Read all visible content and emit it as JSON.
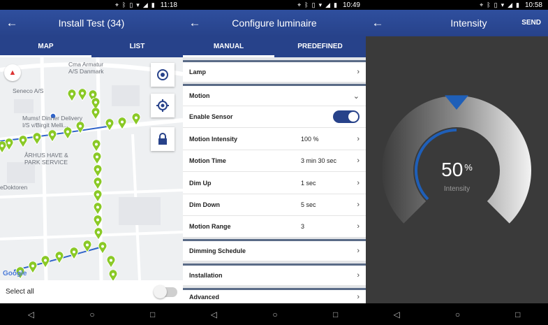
{
  "screen1": {
    "status_time": "11:18",
    "title": "Install Test (34)",
    "tabs": [
      "MAP",
      "LIST"
    ],
    "map_labels": {
      "label1": "Cma Armatur",
      "label2": "A/S Danmark",
      "label3": "Seneco A/S",
      "label4": "Mums! Dinner Delivery",
      "label5": "I/S v/Birgit Melli...",
      "label6": "ÅRHUS HAVE &",
      "label7": "PARK SERVICE",
      "label8": "eDoktoren"
    },
    "google": "Google",
    "select_all": "Select all"
  },
  "screen2": {
    "status_time": "10:49",
    "title": "Configure luminaire",
    "tabs": [
      "MANUAL",
      "PREDEFINED"
    ],
    "rows": {
      "lamp": "Lamp",
      "motion": "Motion",
      "enable_sensor": "Enable Sensor",
      "motion_intensity": {
        "label": "Motion Intensity",
        "value": "100 %"
      },
      "motion_time": {
        "label": "Motion Time",
        "value": "3 min 30 sec"
      },
      "dim_up": {
        "label": "Dim Up",
        "value": "1 sec"
      },
      "dim_down": {
        "label": "Dim Down",
        "value": "5 sec"
      },
      "motion_range": {
        "label": "Motion Range",
        "value": "3"
      },
      "dimming_schedule": "Dimming Schedule",
      "installation": "Installation",
      "advanced": "Advanced"
    }
  },
  "screen3": {
    "status_time": "10:58",
    "title": "Intensity",
    "send": "SEND",
    "value": "50",
    "unit": "%",
    "caption": "Intensity",
    "level_percent": 50
  },
  "colors": {
    "appbar": "#27428a",
    "pin_green": "#8ac926",
    "accent": "#1f5fb8"
  }
}
